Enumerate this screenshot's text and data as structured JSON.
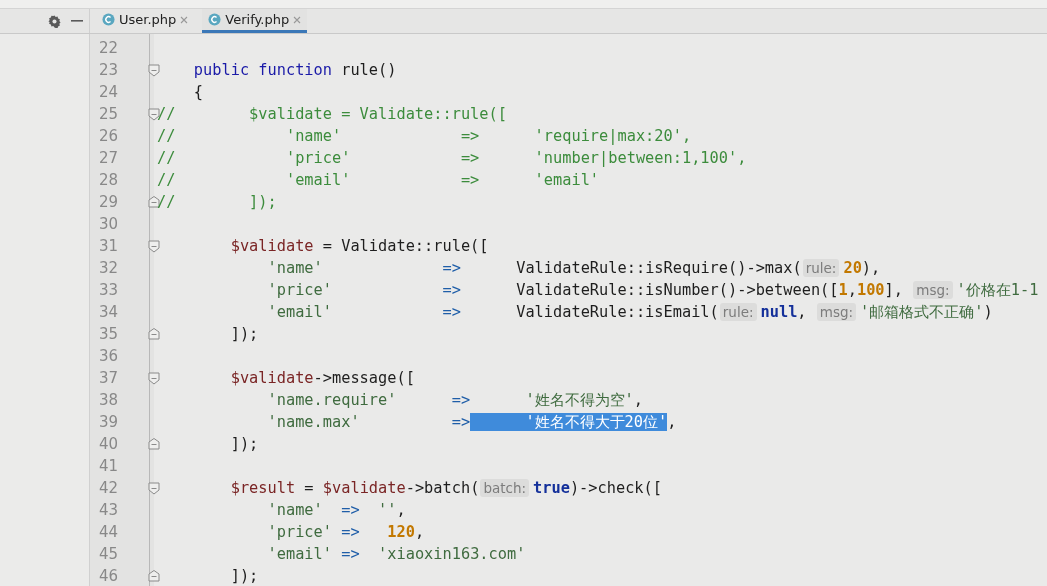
{
  "tabs": [
    {
      "label": "User.php",
      "selected": false
    },
    {
      "label": "Verify.php",
      "selected": true
    }
  ],
  "editor": {
    "lines": [
      {
        "number": "22"
      },
      {
        "number": "23",
        "fold_open": true,
        "tokens": [
          {
            "kind": "kw",
            "text": "    public function "
          },
          {
            "kind": "p",
            "text": "rule()"
          }
        ]
      },
      {
        "number": "24",
        "tokens": [
          {
            "kind": "p",
            "text": "    {"
          }
        ]
      },
      {
        "number": "25",
        "fold_open": true,
        "tokens": [
          {
            "kind": "cmt",
            "text": "//        $validate = Validate::rule(["
          }
        ]
      },
      {
        "number": "26",
        "tokens": [
          {
            "kind": "cmt",
            "text": "//            'name'             =>      'require|max:20',"
          }
        ]
      },
      {
        "number": "27",
        "tokens": [
          {
            "kind": "cmt",
            "text": "//            'price'            =>      'number|between:1,100',"
          }
        ]
      },
      {
        "number": "28",
        "tokens": [
          {
            "kind": "cmt",
            "text": "//            'email'            =>      'email'"
          }
        ]
      },
      {
        "number": "29",
        "fold_close": true,
        "tokens": [
          {
            "kind": "cmt",
            "text": "//        ]);"
          }
        ]
      },
      {
        "number": "30"
      },
      {
        "number": "31",
        "fold_open": true,
        "tokens": [
          {
            "kind": "var",
            "text": "        $validate"
          },
          {
            "kind": "p",
            "text": " = Validate::rule(["
          }
        ]
      },
      {
        "number": "32",
        "tokens": [
          {
            "kind": "str",
            "text": "            'name'"
          },
          {
            "kind": "op",
            "text": "             =>"
          },
          {
            "kind": "p",
            "text": "      ValidateRule::isRequire()->max("
          },
          {
            "kind": "hint",
            "text": "rule:"
          },
          {
            "kind": "num",
            "text": "20"
          },
          {
            "kind": "p",
            "text": "),"
          }
        ]
      },
      {
        "number": "33",
        "tokens": [
          {
            "kind": "str",
            "text": "            'price'"
          },
          {
            "kind": "op",
            "text": "            =>"
          },
          {
            "kind": "p",
            "text": "      ValidateRule::isNumber()->between(["
          },
          {
            "kind": "num",
            "text": "1"
          },
          {
            "kind": "p",
            "text": ","
          },
          {
            "kind": "num",
            "text": "100"
          },
          {
            "kind": "p",
            "text": "], "
          },
          {
            "kind": "hint",
            "text": "msg:"
          },
          {
            "kind": "str",
            "text": "'价格在1-1"
          }
        ]
      },
      {
        "number": "34",
        "tokens": [
          {
            "kind": "str",
            "text": "            'email'"
          },
          {
            "kind": "op",
            "text": "            =>"
          },
          {
            "kind": "p",
            "text": "      ValidateRule::isEmail("
          },
          {
            "kind": "hint",
            "text": "rule:"
          },
          {
            "kind": "lit",
            "text": "null"
          },
          {
            "kind": "p",
            "text": ", "
          },
          {
            "kind": "hint",
            "text": "msg:"
          },
          {
            "kind": "str",
            "text": "'邮箱格式不正确'"
          },
          {
            "kind": "p",
            "text": ")"
          }
        ]
      },
      {
        "number": "35",
        "fold_close": true,
        "tokens": [
          {
            "kind": "p",
            "text": "        ]);"
          }
        ]
      },
      {
        "number": "36"
      },
      {
        "number": "37",
        "fold_open": true,
        "tokens": [
          {
            "kind": "var",
            "text": "        $validate"
          },
          {
            "kind": "p",
            "text": "->message(["
          }
        ]
      },
      {
        "number": "38",
        "tokens": [
          {
            "kind": "str",
            "text": "            'name.require'"
          },
          {
            "kind": "op",
            "text": "      =>"
          },
          {
            "kind": "str",
            "text": "      '姓名不得为空'"
          },
          {
            "kind": "p",
            "text": ","
          }
        ]
      },
      {
        "number": "39",
        "tokens": [
          {
            "kind": "str",
            "text": "            'name.max'",
            "selected": false
          },
          {
            "kind": "op",
            "text": "          =>",
            "selected": false
          },
          {
            "kind": "str",
            "text": "      '姓名不得大于20位'",
            "selected": true
          },
          {
            "kind": "p",
            "text": ",",
            "selected": false
          }
        ]
      },
      {
        "number": "40",
        "fold_close": true,
        "tokens": [
          {
            "kind": "p",
            "text": "        ]);"
          }
        ]
      },
      {
        "number": "41"
      },
      {
        "number": "42",
        "fold_open": true,
        "tokens": [
          {
            "kind": "var",
            "text": "        $result"
          },
          {
            "kind": "p",
            "text": " = "
          },
          {
            "kind": "var",
            "text": "$validate"
          },
          {
            "kind": "p",
            "text": "->batch("
          },
          {
            "kind": "hint",
            "text": "batch:"
          },
          {
            "kind": "lit",
            "text": "true"
          },
          {
            "kind": "p",
            "text": ")->check(["
          }
        ]
      },
      {
        "number": "43",
        "tokens": [
          {
            "kind": "str",
            "text": "            'name'"
          },
          {
            "kind": "op",
            "text": "  =>"
          },
          {
            "kind": "str",
            "text": "  ''"
          },
          {
            "kind": "p",
            "text": ","
          }
        ]
      },
      {
        "number": "44",
        "tokens": [
          {
            "kind": "str",
            "text": "            'price'"
          },
          {
            "kind": "op",
            "text": " =>"
          },
          {
            "kind": "num",
            "text": "   120"
          },
          {
            "kind": "p",
            "text": ","
          }
        ]
      },
      {
        "number": "45",
        "tokens": [
          {
            "kind": "str",
            "text": "            'email'"
          },
          {
            "kind": "op",
            "text": " =>"
          },
          {
            "kind": "str",
            "text": "  'xiaoxin163.com'"
          }
        ]
      },
      {
        "number": "46",
        "fold_close": true,
        "tokens": [
          {
            "kind": "p",
            "text": "        ]);"
          }
        ]
      }
    ]
  }
}
